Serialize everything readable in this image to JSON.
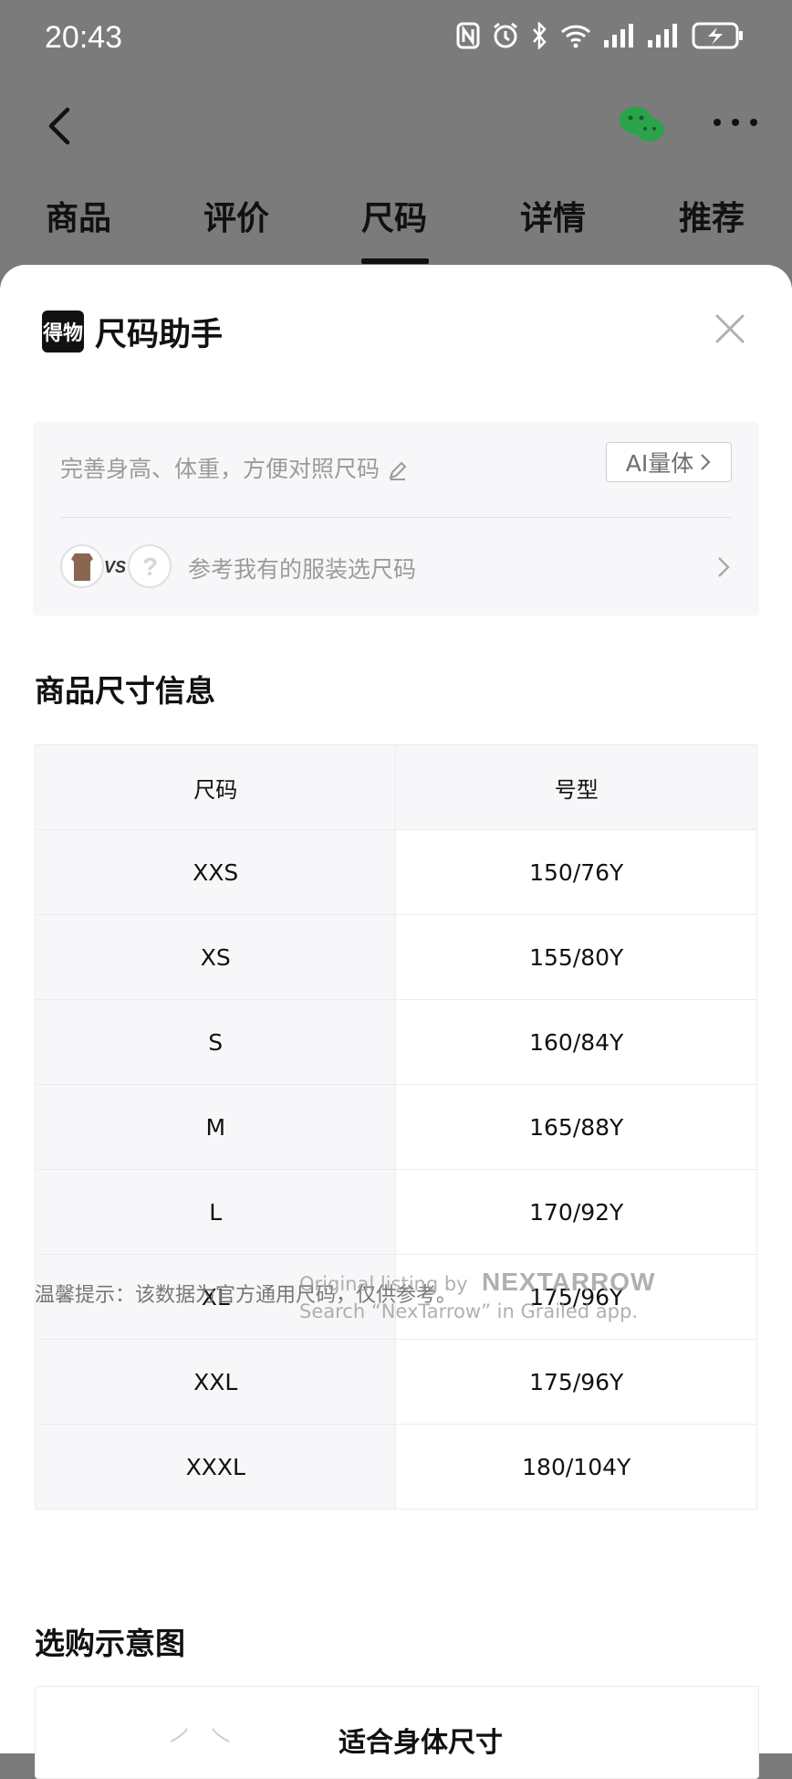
{
  "status_bar": {
    "time": "20:43"
  },
  "tabs": [
    {
      "label": "商品"
    },
    {
      "label": "评价"
    },
    {
      "label": "尺码"
    },
    {
      "label": "详情"
    },
    {
      "label": "推荐"
    }
  ],
  "active_tab": "尺码",
  "sheet": {
    "brand_logo_text": "得物",
    "title": "尺码助手"
  },
  "helper": {
    "hint": "完善身高、体重，方便对照尺码",
    "ai_button": "AI量体",
    "vs_label": "VS",
    "compare_text": "参考我有的服装选尺码"
  },
  "size_info": {
    "title": "商品尺寸信息",
    "headers": [
      "尺码",
      "号型"
    ],
    "rows": [
      [
        "XXS",
        "150/76Y"
      ],
      [
        "XS",
        "155/80Y"
      ],
      [
        "S",
        "160/84Y"
      ],
      [
        "M",
        "165/88Y"
      ],
      [
        "L",
        "170/92Y"
      ],
      [
        "XL",
        "175/96Y"
      ],
      [
        "XXL",
        "175/96Y"
      ],
      [
        "XXXL",
        "180/104Y"
      ]
    ]
  },
  "tip": "温馨提示：该数据为官方通用尺码，仅供参考。",
  "watermark": {
    "line1": "Original listing by",
    "brand": "NEXTARROW",
    "line2": "Search “NexTarrow” in Grailed app."
  },
  "guide": {
    "title": "选购示意图",
    "card_heading": "适合身体尺寸"
  }
}
